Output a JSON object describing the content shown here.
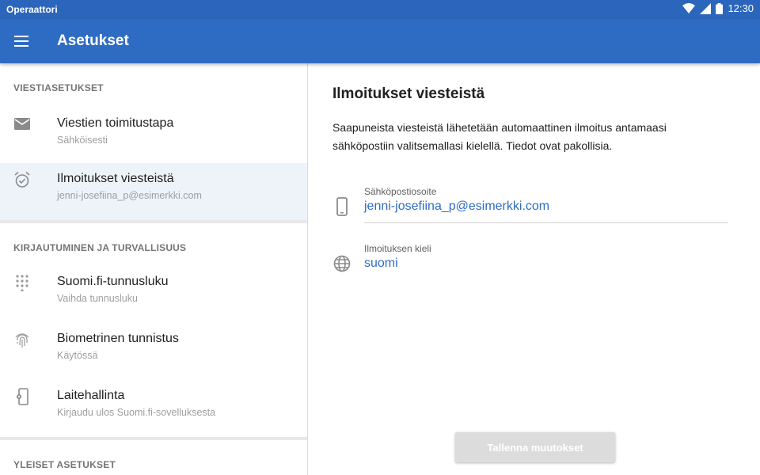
{
  "status_bar": {
    "carrier": "Operaattori",
    "time": "12:30"
  },
  "app_bar": {
    "title": "Asetukset",
    "menu_icon": "menu-icon"
  },
  "sidebar": {
    "sections": [
      {
        "header": "VIESTIASETUKSET",
        "items": [
          {
            "label": "Viestien toimitustapa",
            "sub": "Sähköisesti",
            "icon": "mail-icon"
          },
          {
            "label": "Ilmoitukset viesteistä",
            "sub": "jenni-josefiina_p@esimerkki.com",
            "icon": "alarm-clock-icon",
            "active": true
          }
        ]
      },
      {
        "header": "KIRJAUTUMINEN JA TURVALLISUUS",
        "items": [
          {
            "label": "Suomi.fi-tunnusluku",
            "sub": "Vaihda tunnusluku",
            "icon": "keypad-icon"
          },
          {
            "label": "Biometrinen tunnistus",
            "sub": "Käytössä",
            "icon": "fingerprint-icon"
          },
          {
            "label": "Laitehallinta",
            "sub": "Kirjaudu ulos Suomi.fi-sovelluksesta",
            "icon": "device-settings-icon"
          }
        ]
      },
      {
        "header": "YLEISET ASETUKSET",
        "items": []
      }
    ]
  },
  "main": {
    "title": "Ilmoitukset viesteistä",
    "description": "Saapuneista viesteistä lähetetään automaattinen ilmoitus antamaasi sähköpostiin valitsemallasi kielellä. Tiedot ovat pakollisia.",
    "fields": [
      {
        "label": "Sähköpostiosoite",
        "value": "jenni-josefiina_p@esimerkki.com",
        "icon": "phone-icon"
      },
      {
        "label": "Ilmoituksen kieli",
        "value": "suomi",
        "icon": "globe-icon"
      }
    ],
    "save_label": "Tallenna muutokset"
  },
  "colors": {
    "primary": "#2e6cc4",
    "status_bar": "#2c66bc",
    "active_item_bg": "#eef3fa",
    "link": "#2e6cc4",
    "disabled_button": "#dcdcdc"
  }
}
